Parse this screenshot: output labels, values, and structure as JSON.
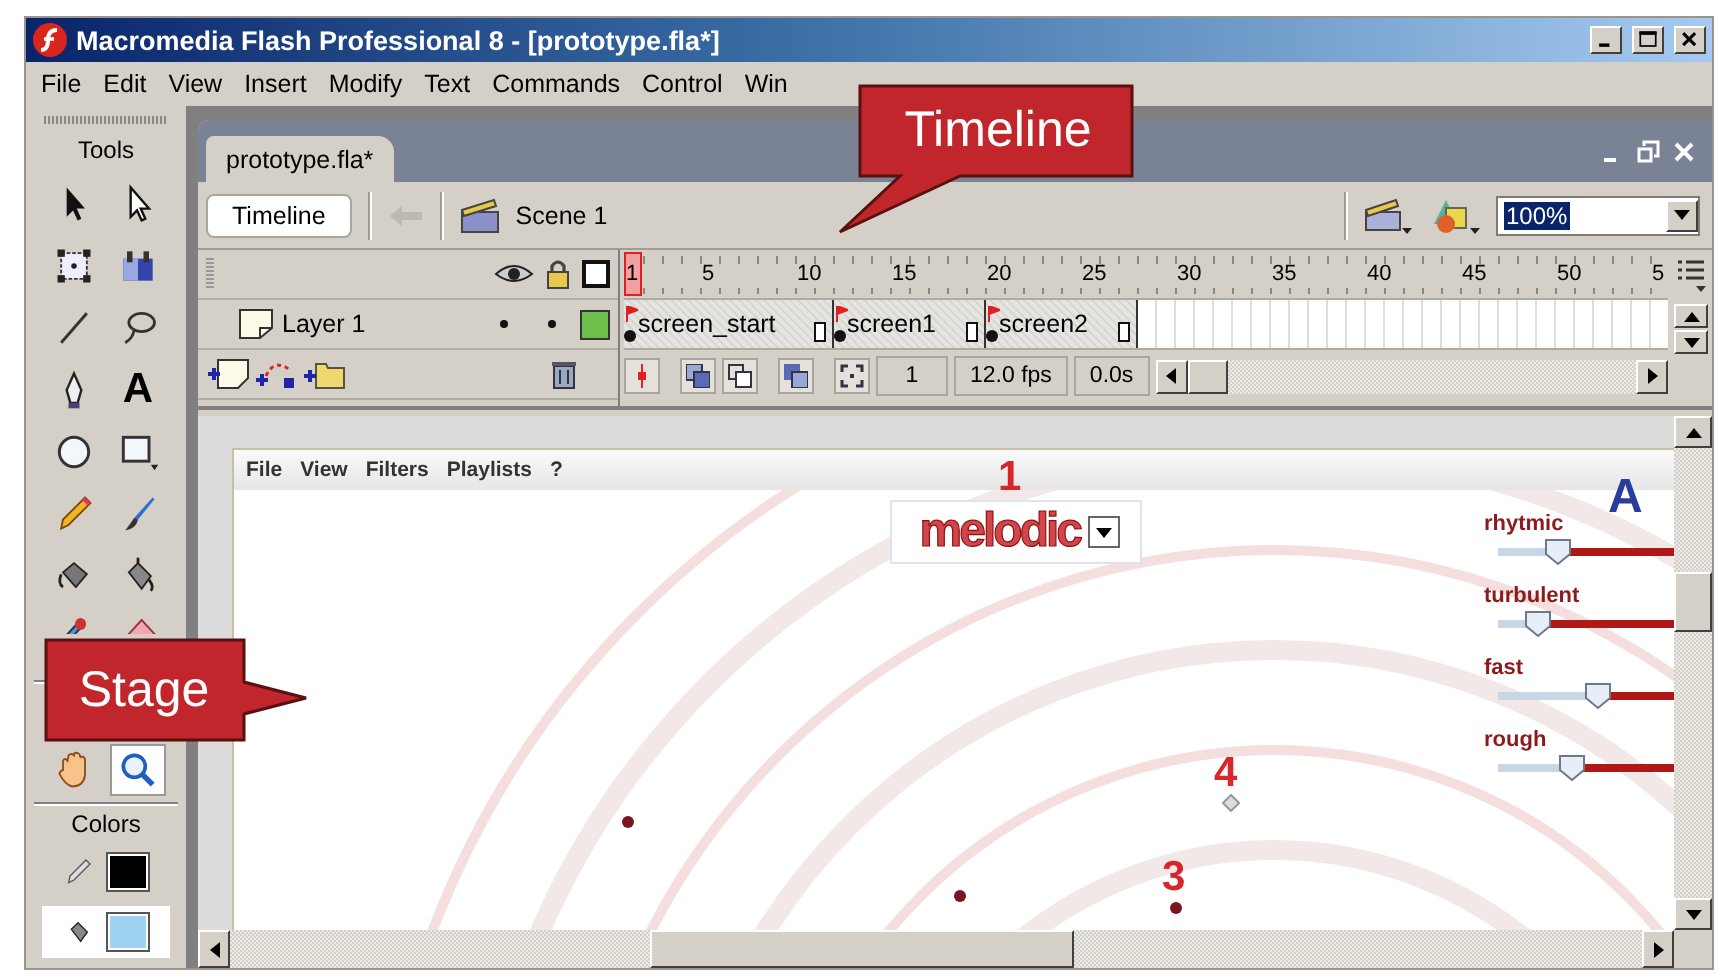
{
  "window": {
    "title": "Macromedia Flash Professional 8 - [prototype.fla*]"
  },
  "menu": [
    "File",
    "Edit",
    "View",
    "Insert",
    "Modify",
    "Text",
    "Commands",
    "Control",
    "Win"
  ],
  "tools_panel": {
    "title": "Tools",
    "tool_groups": [
      [
        {
          "kind": "arrow",
          "selected": false
        },
        {
          "kind": "subselect",
          "selected": false
        },
        {
          "kind": "free-transform",
          "selected": false
        },
        {
          "kind": "gradient",
          "selected": false
        },
        {
          "kind": "line",
          "selected": false
        },
        {
          "kind": "lasso",
          "selected": false
        },
        {
          "kind": "pen",
          "selected": false
        },
        {
          "kind": "text",
          "glyph": "A",
          "selected": false
        },
        {
          "kind": "oval",
          "selected": false
        },
        {
          "kind": "rectangle",
          "selected": false
        },
        {
          "kind": "pencil",
          "selected": false
        },
        {
          "kind": "brush",
          "selected": false
        },
        {
          "kind": "ink-bottle",
          "selected": false
        },
        {
          "kind": "paint-bucket",
          "selected": false
        },
        {
          "kind": "eyedropper",
          "selected": false
        },
        {
          "kind": "eraser",
          "selected": false
        }
      ],
      [
        {
          "kind": "hand",
          "selected": false
        },
        {
          "kind": "zoom",
          "selected": true
        }
      ]
    ],
    "colors_title": "Colors",
    "color_swatches": [
      {
        "kind": "stroke",
        "color": "#000000"
      },
      {
        "kind": "fill",
        "color": "#9fd3f2"
      }
    ]
  },
  "document": {
    "tab": "prototype.fla*",
    "edit_bar": {
      "timeline_button": "Timeline",
      "scene": "Scene 1",
      "zoom": "100%"
    },
    "timeline": {
      "ruler": [
        "1",
        "5",
        "10",
        "15",
        "20",
        "25",
        "30",
        "35",
        "40",
        "45",
        "50",
        "5"
      ],
      "layers": [
        {
          "name": "Layer 1",
          "visible": true,
          "locked": false,
          "color": "#6cc04a"
        }
      ],
      "frame_labels": [
        "screen_start",
        "screen1",
        "screen2"
      ],
      "current_frame": "1",
      "frame_rate": "12.0 fps",
      "elapsed": "0.0s"
    },
    "stage": {
      "menu": [
        "File",
        "View",
        "Filters",
        "Playlists",
        "?"
      ],
      "combo": {
        "value": "melodic"
      },
      "logo": "A",
      "markers": [
        "1",
        "4",
        "3"
      ],
      "sliders": [
        {
          "label": "rhytmic",
          "level": 0.34
        },
        {
          "label": "turbulent",
          "level": 0.23
        },
        {
          "label": "fast",
          "level": 0.57
        },
        {
          "label": "rough",
          "level": 0.42
        }
      ]
    }
  },
  "callouts": [
    "Timeline",
    "Stage"
  ]
}
